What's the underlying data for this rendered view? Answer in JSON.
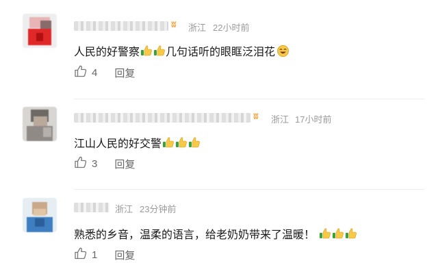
{
  "comments": [
    {
      "location": "浙江",
      "time": "22小时前",
      "text": "人民的好警察",
      "text_after": "几句话听的眼眶泛泪花",
      "likes": "4",
      "reply_label": "回复",
      "vip": true
    },
    {
      "location": "浙江",
      "time": "17小时前",
      "text": "江山人民的好交警",
      "likes": "3",
      "reply_label": "回复",
      "vip": true
    },
    {
      "location": "浙江",
      "time": "23分钟前",
      "text": "熟悉的乡音，温柔的语言，给老奶奶带来了温暖！",
      "likes": "1",
      "reply_label": "回复",
      "vip": false
    }
  ],
  "colors": {
    "accent_vip": "#f3a23a",
    "meta": "#9a9a9a",
    "action": "#666666"
  },
  "icons": {
    "like": "thumbs-up-outline-icon",
    "emoji_thumb": "thumbs-up-emoji",
    "emoji_laugh": "laughing-tears-emoji",
    "vip": "vip-badge-icon"
  }
}
